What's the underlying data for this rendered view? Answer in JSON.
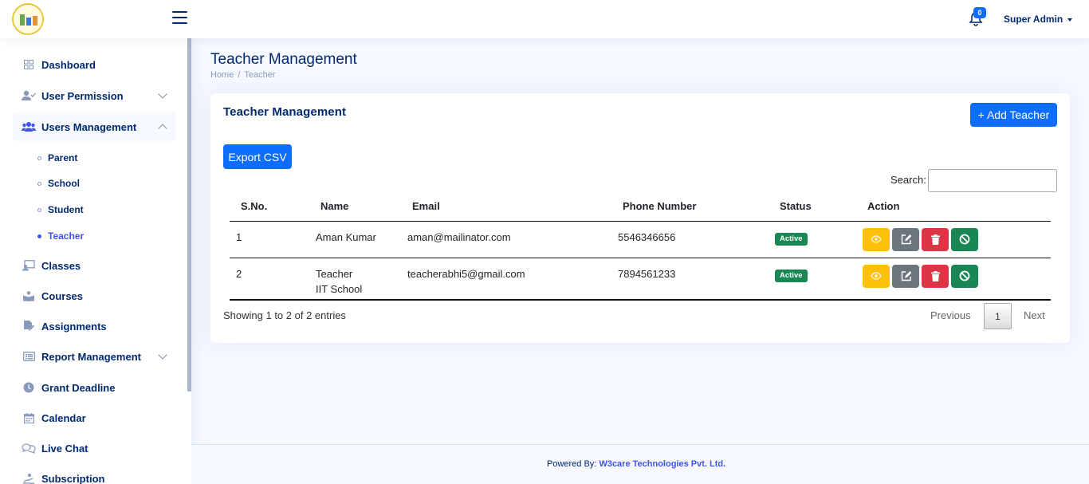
{
  "header": {
    "notifications_count": "0",
    "user_name": "Super Admin"
  },
  "sidebar": {
    "items": [
      {
        "label": "Dashboard",
        "icon": "grid-icon"
      },
      {
        "label": "User Permission",
        "icon": "user-check-icon"
      },
      {
        "label": "Users Management",
        "icon": "people-icon"
      },
      {
        "label": "Classes",
        "icon": "person-video-icon"
      },
      {
        "label": "Courses",
        "icon": "book-icon"
      },
      {
        "label": "Assignments",
        "icon": "file-edit-icon"
      },
      {
        "label": "Report Management",
        "icon": "list-icon"
      },
      {
        "label": "Grant Deadline",
        "icon": "clock-icon"
      },
      {
        "label": "Calendar",
        "icon": "calendar-icon"
      },
      {
        "label": "Live Chat",
        "icon": "chat-icon"
      },
      {
        "label": "Subscription",
        "icon": "subscription-icon"
      }
    ],
    "subitems": [
      "Parent",
      "School",
      "Student",
      "Teacher"
    ]
  },
  "page": {
    "title": "Teacher Management",
    "breadcrumb": [
      "Home",
      "Teacher"
    ]
  },
  "card": {
    "title": "Teacher Management",
    "add_button": "+ Add Teacher",
    "export_button": "Export CSV",
    "search_label": "Search:",
    "search_value": ""
  },
  "table": {
    "columns": [
      "S.No.",
      "Name",
      "Email",
      "Phone Number",
      "Status",
      "Action"
    ],
    "rows": [
      {
        "sno": "1",
        "name_line1": "Aman Kumar",
        "name_line2": "",
        "email": "aman@mailinator.com",
        "phone": "5546346656",
        "status": "Active"
      },
      {
        "sno": "2",
        "name_line1": "Teacher",
        "name_line2": "IIT School",
        "email": "teacherabhi5@gmail.com",
        "phone": "7894561233",
        "status": "Active"
      }
    ]
  },
  "pagination": {
    "info": "Showing 1 to 2 of 2 entries",
    "previous": "Previous",
    "current": "1",
    "next": "Next"
  },
  "footer": {
    "prefix": "Powered By:",
    "company": "W3care Technologies Pvt. Ltd."
  },
  "colors": {
    "primary": "#0d6efd",
    "navy": "#012970",
    "success": "#198754",
    "warning": "#ffc107",
    "danger": "#dc3545",
    "secondary": "#6c757d"
  }
}
